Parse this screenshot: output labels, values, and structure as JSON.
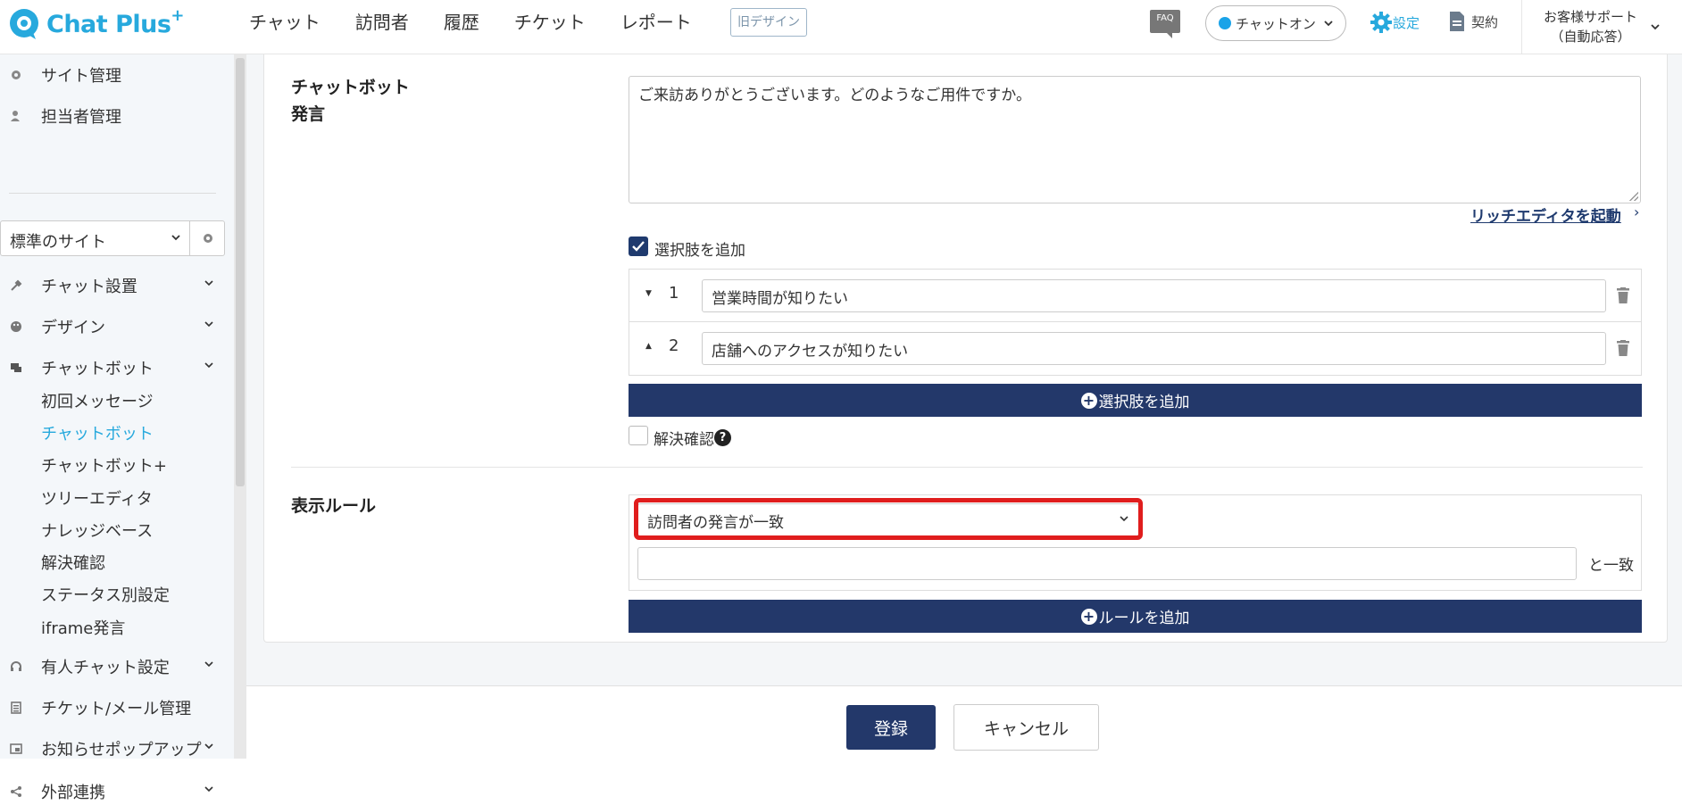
{
  "header": {
    "logo_text": "Chat Plus",
    "logo_plus": "+",
    "nav": [
      "チャット",
      "訪問者",
      "履歴",
      "チケット",
      "レポート"
    ],
    "old_design": "旧デザイン",
    "faq": "FAQ",
    "chat_status": "チャットオン",
    "settings": "設定",
    "contract": "契約",
    "support_line1": "お客様サポート",
    "support_line2": "（自動応答）"
  },
  "sidebar": {
    "site_admin": "サイト管理",
    "staff_admin": "担当者管理",
    "site_select": "標準のサイト",
    "chat_setup": "チャット設置",
    "design": "デザイン",
    "chatbot": "チャットボット",
    "chatbot_sub": [
      "初回メッセージ",
      "チャットボット",
      "チャットボット+",
      "ツリーエディタ",
      "ナレッジベース",
      "解決確認",
      "ステータス別設定",
      "iframe発言"
    ],
    "active_sub": "チャットボット",
    "live_chat": "有人チャット設定",
    "ticket_mail": "チケット/メール管理",
    "notice_popup": "お知らせポップアップ",
    "external": "外部連携"
  },
  "form": {
    "bot_label_1": "チャットボット",
    "bot_label_2": "発言",
    "bot_message": "ご来訪ありがとうございます。どのようなご用件ですか。",
    "rich_editor": "リッチエディタを起動",
    "add_choices_label": "選択肢を追加",
    "choices": [
      {
        "num": "1",
        "text": "営業時間が知りたい"
      },
      {
        "num": "2",
        "text": "店舗へのアクセスが知りたい"
      }
    ],
    "add_choice_button": "選択肢を追加",
    "resolve_confirm": "解決確認",
    "display_rule_label": "表示ルール",
    "rule_select": "訪問者の発言が一致",
    "rule_input": "",
    "match_suffix": "と一致",
    "add_rule_button": "ルールを追加"
  },
  "footer": {
    "submit": "登録",
    "cancel": "キャンセル"
  },
  "colors": {
    "brand": "#27a9dd",
    "navy": "#23386a",
    "highlight": "#e01d1d"
  }
}
